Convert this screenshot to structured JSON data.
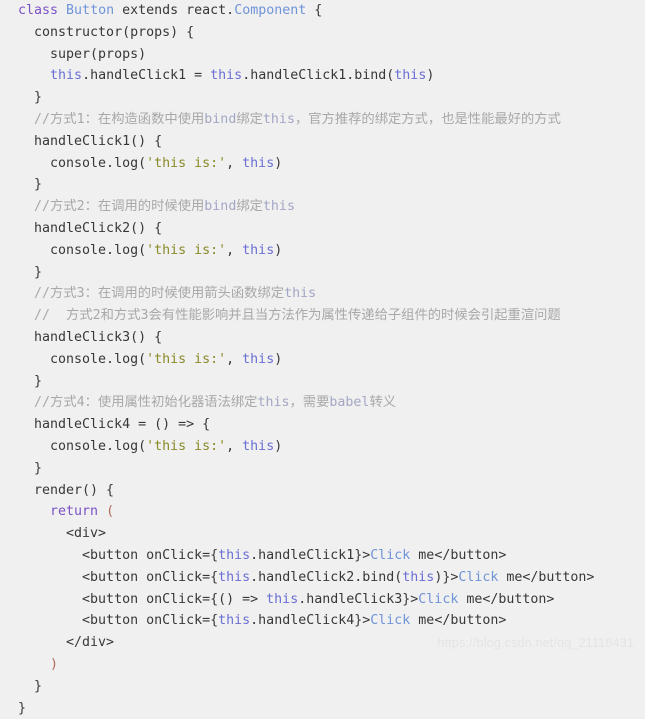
{
  "editor": {
    "background_color": "#f0f0f0",
    "default_text_color": "#383838",
    "language": "javascript-jsx",
    "colors": {
      "keyword": "#7b52c4",
      "type": "#6f94d8",
      "this_keyword": "#6a6fd4",
      "string": "#8a8a28",
      "comment": "#a8a8a8",
      "comment_keyword": "#a3a7c4",
      "jsx_text": "#6f94d8",
      "bracket": "#b06a5a"
    }
  },
  "lines": [
    {
      "id": 1,
      "text": "class Button extends react.Component {"
    },
    {
      "id": 2,
      "text": "  constructor(props) {"
    },
    {
      "id": 3,
      "text": "    super(props)"
    },
    {
      "id": 4,
      "text": "    this.handleClick1 = this.handleClick1.bind(this)"
    },
    {
      "id": 5,
      "text": "  }"
    },
    {
      "id": 6,
      "text": "  //方式1：在构造函数中使用bind绑定this，官方推荐的绑定方式，也是性能最好的方式"
    },
    {
      "id": 7,
      "text": "  handleClick1() {"
    },
    {
      "id": 8,
      "text": "    console.log('this is:', this)"
    },
    {
      "id": 9,
      "text": "  }"
    },
    {
      "id": 10,
      "text": "  //方式2：在调用的时候使用bind绑定this"
    },
    {
      "id": 11,
      "text": "  handleClick2() {"
    },
    {
      "id": 12,
      "text": "    console.log('this is:', this)"
    },
    {
      "id": 13,
      "text": "  }"
    },
    {
      "id": 14,
      "text": "  //方式3：在调用的时候使用箭头函数绑定this"
    },
    {
      "id": 15,
      "text": "  //  方式2和方式3会有性能影响并且当方法作为属性传递给子组件的时候会引起重渲问题"
    },
    {
      "id": 16,
      "text": "  handleClick3() {"
    },
    {
      "id": 17,
      "text": "    console.log('this is:', this)"
    },
    {
      "id": 18,
      "text": "  }"
    },
    {
      "id": 19,
      "text": "  //方式4：使用属性初始化器语法绑定this，需要babel转义"
    },
    {
      "id": 20,
      "text": "  handleClick4 = () => {"
    },
    {
      "id": 21,
      "text": "    console.log('this is:', this)"
    },
    {
      "id": 22,
      "text": "  }"
    },
    {
      "id": 23,
      "text": "  render() {"
    },
    {
      "id": 24,
      "text": "    return ("
    },
    {
      "id": 25,
      "text": "      <div>"
    },
    {
      "id": 26,
      "text": "        <button onClick={this.handleClick1}>Click me</button>"
    },
    {
      "id": 27,
      "text": "        <button onClick={this.handleClick2.bind(this)}>Click me</button>"
    },
    {
      "id": 28,
      "text": "        <button onClick={() => this.handleClick3}>Click me</button>"
    },
    {
      "id": 29,
      "text": "        <button onClick={this.handleClick4}>Click me</button>"
    },
    {
      "id": 30,
      "text": "      </div>"
    },
    {
      "id": 31,
      "text": "    )"
    },
    {
      "id": 32,
      "text": "  }"
    },
    {
      "id": 33,
      "text": "}"
    }
  ],
  "watermark": {
    "text": "https://blog.csdn.net/qq_21118431"
  }
}
